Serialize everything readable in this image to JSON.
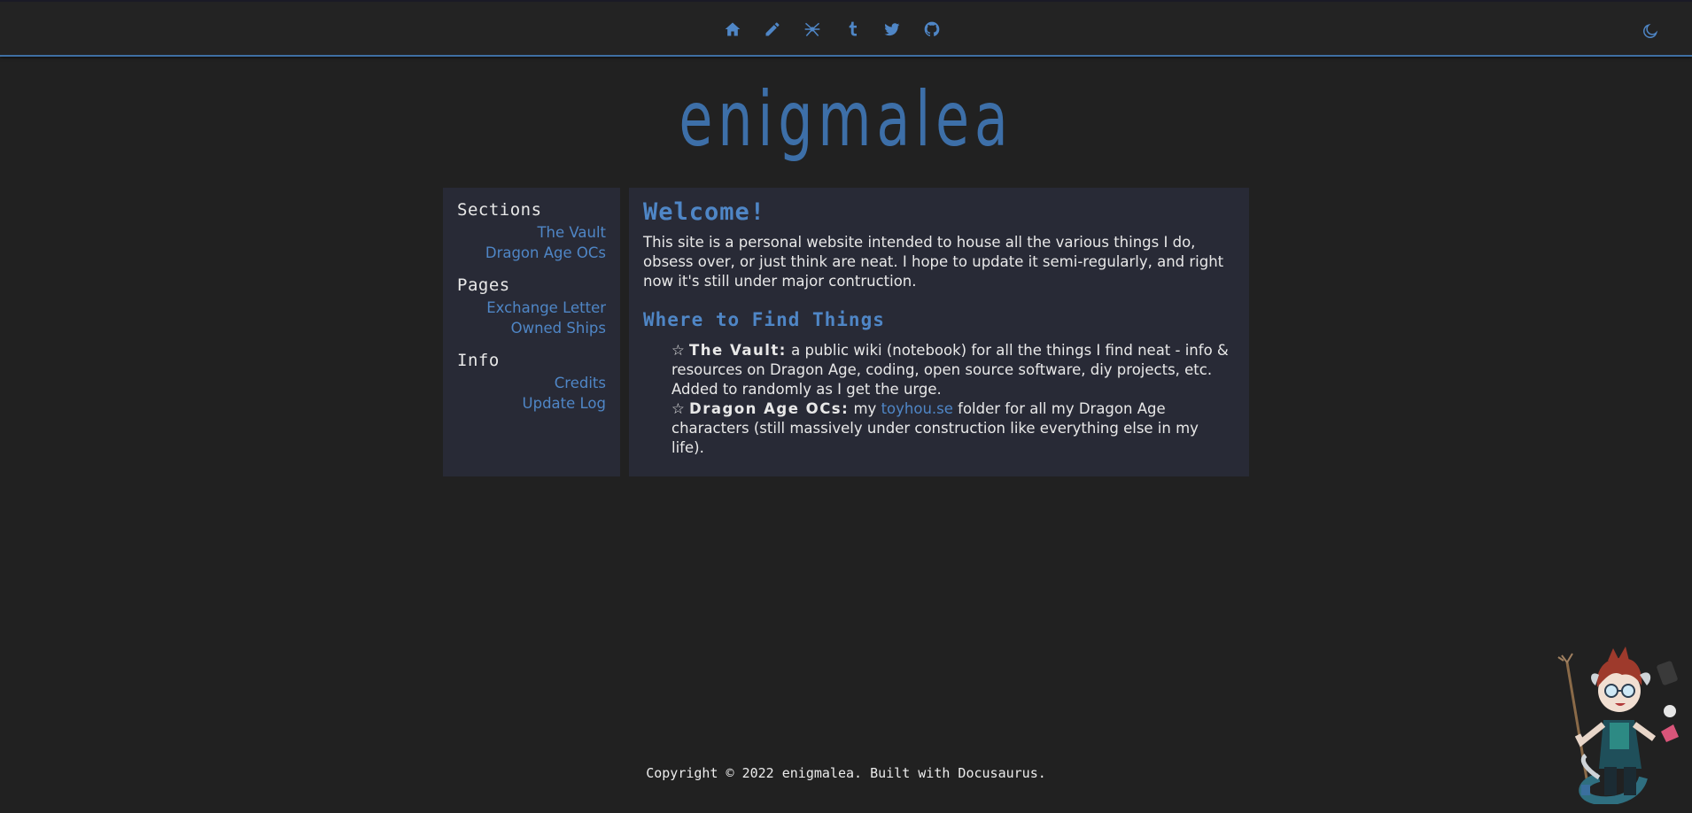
{
  "nav": {
    "icons": [
      "home-icon",
      "pencil-icon",
      "spider-icon",
      "tumblr-icon",
      "twitter-icon",
      "github-icon"
    ],
    "theme_toggle_icon": "moon-icon"
  },
  "site_title": "enigmalea",
  "sidebar": {
    "groups": [
      {
        "heading": "Sections",
        "links": [
          "The Vault",
          "Dragon Age OCs"
        ]
      },
      {
        "heading": "Pages",
        "links": [
          "Exchange Letter",
          "Owned Ships"
        ]
      },
      {
        "heading": "Info",
        "links": [
          "Credits",
          "Update Log"
        ]
      }
    ]
  },
  "main": {
    "welcome_heading": "Welcome!",
    "intro": "This site is a personal website intended to house all the various things I do, obsess over, or just think are neat. I hope to update it semi-regularly, and right now it's still under major contruction.",
    "find_heading": "Where to Find Things",
    "items": [
      {
        "star": "☆",
        "title": "The Vault:",
        "text": " a public wiki (notebook) for all the things I find neat - info & resources on Dragon Age, coding, open source software, diy projects, etc. Added to randomly as I get the urge."
      },
      {
        "star": "☆",
        "title": "Dragon Age OCs:",
        "text_before": " my ",
        "link": "toyhou.se",
        "text_after": " folder for all my Dragon Age characters (still massively under construction like everything else in my life)."
      }
    ]
  },
  "footer": "Copyright © 2022 enigmalea. Built with Docusaurus.",
  "colors": {
    "accent": "#4f86c6",
    "background": "#212121",
    "panel": "#282a36"
  }
}
